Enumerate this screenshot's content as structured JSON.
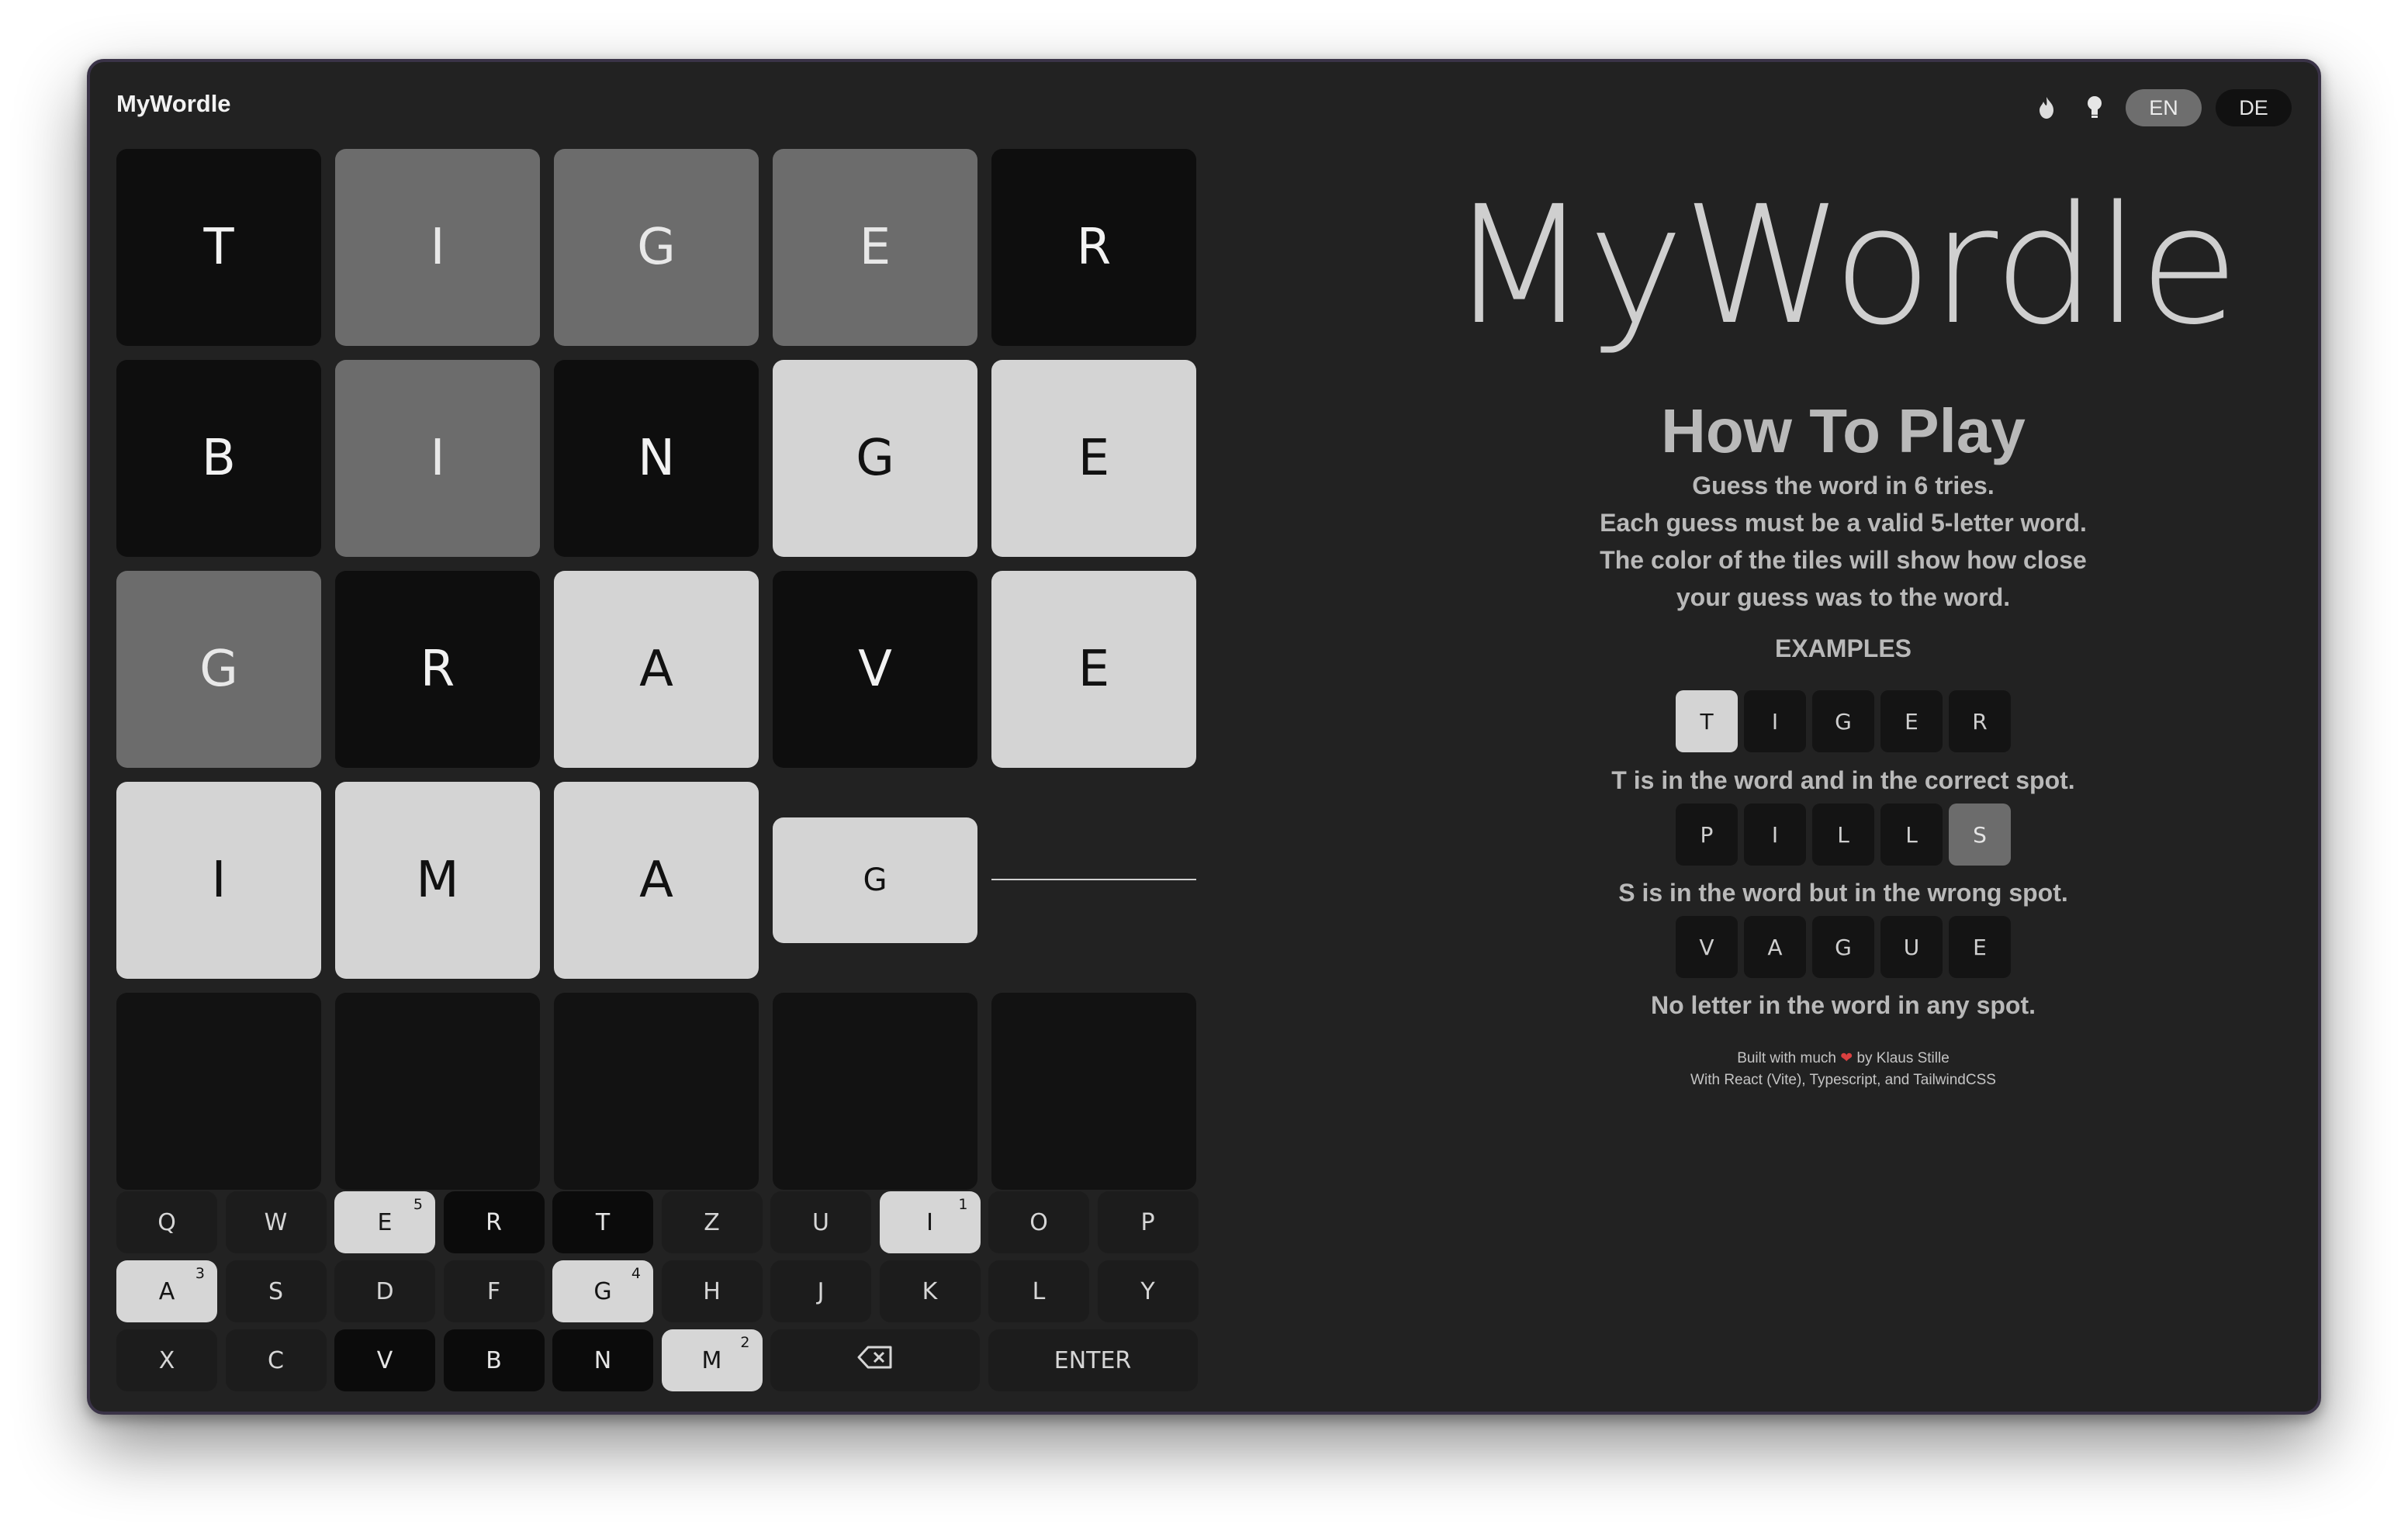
{
  "app": {
    "title": "MyWordle"
  },
  "header": {
    "icons": [
      "flame-icon",
      "lightbulb-icon"
    ],
    "languages": [
      {
        "label": "EN",
        "active": true
      },
      {
        "label": "DE",
        "active": false
      }
    ]
  },
  "board": {
    "rows": [
      [
        {
          "letter": "T",
          "state": "absent"
        },
        {
          "letter": "I",
          "state": "present"
        },
        {
          "letter": "G",
          "state": "present"
        },
        {
          "letter": "E",
          "state": "present"
        },
        {
          "letter": "R",
          "state": "absent"
        }
      ],
      [
        {
          "letter": "B",
          "state": "absent"
        },
        {
          "letter": "I",
          "state": "present"
        },
        {
          "letter": "N",
          "state": "absent"
        },
        {
          "letter": "G",
          "state": "correct"
        },
        {
          "letter": "E",
          "state": "correct"
        }
      ],
      [
        {
          "letter": "G",
          "state": "present"
        },
        {
          "letter": "R",
          "state": "absent"
        },
        {
          "letter": "A",
          "state": "correct"
        },
        {
          "letter": "V",
          "state": "absent"
        },
        {
          "letter": "E",
          "state": "correct"
        }
      ],
      [
        {
          "letter": "I",
          "state": "correct"
        },
        {
          "letter": "M",
          "state": "correct"
        },
        {
          "letter": "A",
          "state": "correct"
        },
        {
          "letter": "G",
          "state": "correct"
        },
        {
          "letter": "",
          "state": "flipping"
        }
      ],
      [
        {
          "letter": "",
          "state": "empty"
        },
        {
          "letter": "",
          "state": "empty"
        },
        {
          "letter": "",
          "state": "empty"
        },
        {
          "letter": "",
          "state": "empty"
        },
        {
          "letter": "",
          "state": "empty"
        }
      ]
    ]
  },
  "keyboard": {
    "rows": [
      [
        {
          "label": "Q",
          "state": "unused"
        },
        {
          "label": "W",
          "state": "unused"
        },
        {
          "label": "E",
          "state": "correct",
          "badge": "5"
        },
        {
          "label": "R",
          "state": "absent"
        },
        {
          "label": "T",
          "state": "absent"
        },
        {
          "label": "Z",
          "state": "unused"
        },
        {
          "label": "U",
          "state": "unused"
        },
        {
          "label": "I",
          "state": "correct",
          "badge": "1"
        },
        {
          "label": "O",
          "state": "unused"
        },
        {
          "label": "P",
          "state": "unused"
        }
      ],
      [
        {
          "label": "A",
          "state": "correct",
          "badge": "3"
        },
        {
          "label": "S",
          "state": "unused"
        },
        {
          "label": "D",
          "state": "unused"
        },
        {
          "label": "F",
          "state": "unused"
        },
        {
          "label": "G",
          "state": "correct",
          "badge": "4"
        },
        {
          "label": "H",
          "state": "unused"
        },
        {
          "label": "J",
          "state": "unused"
        },
        {
          "label": "K",
          "state": "unused"
        },
        {
          "label": "L",
          "state": "unused"
        },
        {
          "label": "Y",
          "state": "unused"
        }
      ],
      [
        {
          "label": "X",
          "state": "unused"
        },
        {
          "label": "C",
          "state": "unused"
        },
        {
          "label": "V",
          "state": "absent"
        },
        {
          "label": "B",
          "state": "absent"
        },
        {
          "label": "N",
          "state": "absent"
        },
        {
          "label": "M",
          "state": "correct",
          "badge": "2"
        },
        {
          "label": "",
          "state": "unused",
          "icon": "backspace-icon"
        },
        {
          "label": "ENTER",
          "state": "unused"
        }
      ]
    ]
  },
  "info": {
    "logo_text": "MyWordle",
    "how_title": "How To Play",
    "how_lines": [
      "Guess the word in 6 tries.",
      "Each guess must be a valid 5-letter word.",
      "The color of the tiles will show how close",
      "your guess was to the word."
    ],
    "examples_label": "EXAMPLES",
    "examples": [
      {
        "letters": [
          "T",
          "I",
          "G",
          "E",
          "R"
        ],
        "states": [
          "correct",
          "plain",
          "plain",
          "plain",
          "plain"
        ],
        "description": "T is in the word and in the correct spot."
      },
      {
        "letters": [
          "P",
          "I",
          "L",
          "L",
          "S"
        ],
        "states": [
          "plain",
          "plain",
          "plain",
          "plain",
          "present"
        ],
        "description": "S is in the word but in the wrong spot."
      },
      {
        "letters": [
          "V",
          "A",
          "G",
          "U",
          "E"
        ],
        "states": [
          "plain",
          "plain",
          "plain",
          "plain",
          "plain"
        ],
        "description": "No letter in the word in any spot."
      }
    ],
    "footer_line1_a": "Built with much",
    "footer_line1_b": "by Klaus Stille",
    "footer_line2": "With React (Vite), Typescript, and TailwindCSS"
  },
  "colors": {
    "window_bg": "#222222",
    "absent": "#0e0e0e",
    "present": "#6c6c6c",
    "correct": "#d4d4d4",
    "heart": "#d94040"
  }
}
